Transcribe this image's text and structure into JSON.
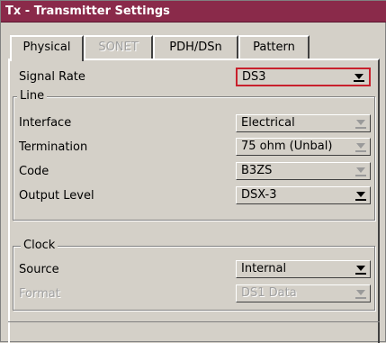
{
  "window": {
    "title": "Tx - Transmitter Settings"
  },
  "tabs": [
    {
      "label": "Physical",
      "state": "active"
    },
    {
      "label": "SONET",
      "state": "disabled"
    },
    {
      "label": "PDH/DSn",
      "state": "normal"
    },
    {
      "label": "Pattern",
      "state": "normal"
    }
  ],
  "signal_rate": {
    "label": "Signal Rate",
    "value": "DS3"
  },
  "line": {
    "legend": "Line",
    "interface": {
      "label": "Interface",
      "value": "Electrical"
    },
    "termination": {
      "label": "Termination",
      "value": "75 ohm (Unbal)"
    },
    "code": {
      "label": "Code",
      "value": "B3ZS"
    },
    "output_level": {
      "label": "Output Level",
      "value": "DSX-3"
    }
  },
  "clock": {
    "legend": "Clock",
    "source": {
      "label": "Source",
      "value": "Internal"
    },
    "format": {
      "label": "Format",
      "value": "DS1 Data"
    }
  },
  "colors": {
    "titlebar": "#8a2a4a",
    "background": "#d4d0c8",
    "focus_border": "#c8202c"
  }
}
